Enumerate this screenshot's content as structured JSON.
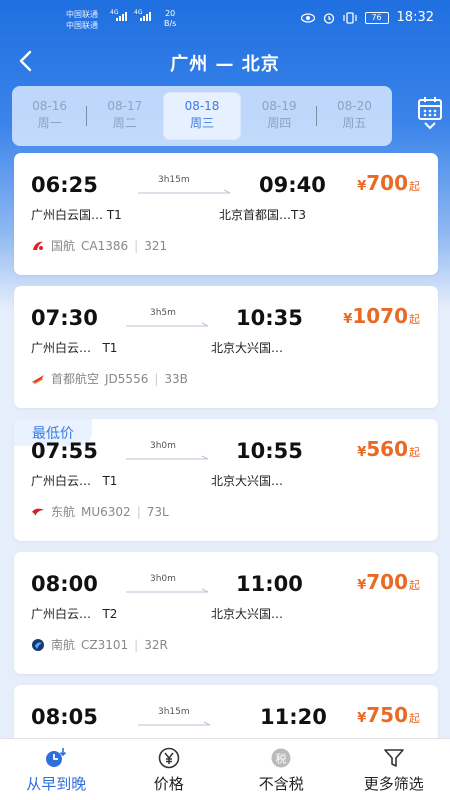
{
  "status_bar": {
    "carrier1": "中国联通",
    "carrier2": "中国联通",
    "net1": "4G",
    "net2": "4G",
    "speed_value": "20",
    "speed_unit": "B/s",
    "battery": "76",
    "time": "18:32"
  },
  "header": {
    "route": "广州 — 北京"
  },
  "dates": [
    {
      "date": "08-16",
      "weekday": "周一"
    },
    {
      "date": "08-17",
      "weekday": "周二"
    },
    {
      "date": "08-18",
      "weekday": "周三"
    },
    {
      "date": "08-19",
      "weekday": "周四"
    },
    {
      "date": "08-20",
      "weekday": "周五"
    }
  ],
  "selected_date_index": 2,
  "flights": [
    {
      "dep_time": "06:25",
      "arr_time": "09:40",
      "duration": "3h15m",
      "dep_airport": "广州白云国…",
      "dep_terminal": "T1",
      "arr_airport": "北京首都国…T3",
      "price": "700",
      "currency": "¥",
      "price_suffix": "起",
      "airline": "国航",
      "flight_no": "CA1386",
      "aircraft": "321",
      "airline_icon": "air-china-icon",
      "tag": ""
    },
    {
      "dep_time": "07:30",
      "arr_time": "10:35",
      "duration": "3h5m",
      "dep_airport": "广州白云…",
      "dep_terminal": "T1",
      "arr_airport": "北京大兴国…",
      "price": "1070",
      "currency": "¥",
      "price_suffix": "起",
      "airline": "首都航空",
      "flight_no": "JD5556",
      "aircraft": "33B",
      "airline_icon": "capital-airlines-icon",
      "tag": ""
    },
    {
      "dep_time": "07:55",
      "arr_time": "10:55",
      "duration": "3h0m",
      "dep_airport": "广州白云…",
      "dep_terminal": "T1",
      "arr_airport": "北京大兴国…",
      "price": "560",
      "currency": "¥",
      "price_suffix": "起",
      "airline": "东航",
      "flight_no": "MU6302",
      "aircraft": "73L",
      "airline_icon": "china-eastern-icon",
      "tag": "最低价"
    },
    {
      "dep_time": "08:00",
      "arr_time": "11:00",
      "duration": "3h0m",
      "dep_airport": "广州白云…",
      "dep_terminal": "T2",
      "arr_airport": "北京大兴国…",
      "price": "700",
      "currency": "¥",
      "price_suffix": "起",
      "airline": "南航",
      "flight_no": "CZ3101",
      "aircraft": "32R",
      "airline_icon": "china-southern-icon",
      "tag": ""
    },
    {
      "dep_time": "08:05",
      "arr_time": "11:20",
      "duration": "3h15m",
      "dep_airport": "",
      "dep_terminal": "",
      "arr_airport": "",
      "price": "750",
      "currency": "¥",
      "price_suffix": "起",
      "airline": "",
      "flight_no": "",
      "aircraft": "",
      "airline_icon": "",
      "tag": ""
    }
  ],
  "bottom_tabs": [
    {
      "label": "从早到晚",
      "icon": "clock-sort-icon",
      "active": true
    },
    {
      "label": "价格",
      "icon": "yen-icon",
      "active": false
    },
    {
      "label": "不含税",
      "icon": "tax-icon",
      "tax_glyph": "税",
      "active": false
    },
    {
      "label": "更多筛选",
      "icon": "filter-icon",
      "active": false
    }
  ],
  "colors": {
    "accent": "#2f6fdc",
    "price": "#e86a24",
    "header_bg": "#1f6fe0"
  }
}
